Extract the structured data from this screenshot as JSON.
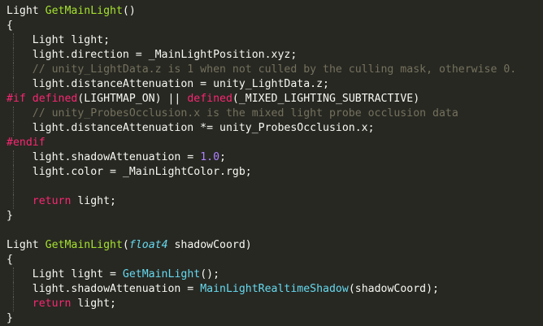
{
  "theme": {
    "background": "#272822",
    "plain": "#f8f8f2",
    "function": "#a6e22e",
    "comment": "#75715e",
    "keyword": "#f92672",
    "number": "#ae81ff",
    "type_italic": "#66d9ef",
    "guide": "#5a5a50"
  },
  "lines": [
    {
      "guide": false,
      "tokens": [
        {
          "text": "Light ",
          "c": "plain"
        },
        {
          "text": "GetMainLight",
          "c": "function"
        },
        {
          "text": "()",
          "c": "plain"
        }
      ]
    },
    {
      "guide": false,
      "tokens": [
        {
          "text": "{",
          "c": "plain"
        }
      ]
    },
    {
      "guide": true,
      "tokens": [
        {
          "text": "    Light light;",
          "c": "plain"
        }
      ]
    },
    {
      "guide": true,
      "tokens": [
        {
          "text": "    light.direction = _MainLightPosition.xyz;",
          "c": "plain"
        }
      ]
    },
    {
      "guide": true,
      "tokens": [
        {
          "text": "    // unity_LightData.z is 1 when not culled by the culling mask, otherwise 0.",
          "c": "comment"
        }
      ]
    },
    {
      "guide": true,
      "tokens": [
        {
          "text": "    light.distanceAttenuation = unity_LightData.z;",
          "c": "plain"
        }
      ]
    },
    {
      "guide": false,
      "tokens": [
        {
          "text": "#if ",
          "c": "keyword"
        },
        {
          "text": "defined",
          "c": "keyword"
        },
        {
          "text": "(LIGHTMAP_ON) || ",
          "c": "plain"
        },
        {
          "text": "defined",
          "c": "keyword"
        },
        {
          "text": "(_MIXED_LIGHTING_SUBTRACTIVE)",
          "c": "plain"
        }
      ]
    },
    {
      "guide": true,
      "tokens": [
        {
          "text": "    // unity_ProbesOcclusion.x is the mixed light probe occlusion data",
          "c": "comment"
        }
      ]
    },
    {
      "guide": true,
      "tokens": [
        {
          "text": "    light.distanceAttenuation *= unity_ProbesOcclusion.x;",
          "c": "plain"
        }
      ]
    },
    {
      "guide": false,
      "tokens": [
        {
          "text": "#endif",
          "c": "keyword"
        }
      ]
    },
    {
      "guide": true,
      "tokens": [
        {
          "text": "    light.shadowAttenuation = ",
          "c": "plain"
        },
        {
          "text": "1.0",
          "c": "number"
        },
        {
          "text": ";",
          "c": "plain"
        }
      ]
    },
    {
      "guide": true,
      "tokens": [
        {
          "text": "    light.color = _MainLightColor.rgb;",
          "c": "plain"
        }
      ]
    },
    {
      "guide": true,
      "tokens": [
        {
          "text": "",
          "c": "plain"
        }
      ]
    },
    {
      "guide": true,
      "tokens": [
        {
          "text": "    ",
          "c": "plain"
        },
        {
          "text": "return",
          "c": "keyword"
        },
        {
          "text": " light;",
          "c": "plain"
        }
      ]
    },
    {
      "guide": false,
      "tokens": [
        {
          "text": "}",
          "c": "plain"
        }
      ]
    },
    {
      "guide": false,
      "tokens": [
        {
          "text": "",
          "c": "plain"
        }
      ]
    },
    {
      "guide": false,
      "tokens": [
        {
          "text": "Light ",
          "c": "plain"
        },
        {
          "text": "GetMainLight",
          "c": "function"
        },
        {
          "text": "(",
          "c": "plain"
        },
        {
          "text": "float4",
          "c": "type_italic",
          "italic": true
        },
        {
          "text": " shadowCoord)",
          "c": "plain"
        }
      ]
    },
    {
      "guide": false,
      "tokens": [
        {
          "text": "{",
          "c": "plain"
        }
      ]
    },
    {
      "guide": true,
      "tokens": [
        {
          "text": "    Light light = ",
          "c": "plain"
        },
        {
          "text": "GetMainLight",
          "c": "type_italic"
        },
        {
          "text": "();",
          "c": "plain"
        }
      ]
    },
    {
      "guide": true,
      "tokens": [
        {
          "text": "    light.shadowAttenuation = ",
          "c": "plain"
        },
        {
          "text": "MainLightRealtimeShadow",
          "c": "type_italic"
        },
        {
          "text": "(shadowCoord);",
          "c": "plain"
        }
      ]
    },
    {
      "guide": true,
      "tokens": [
        {
          "text": "    ",
          "c": "plain"
        },
        {
          "text": "return",
          "c": "keyword"
        },
        {
          "text": " light;",
          "c": "plain"
        }
      ]
    },
    {
      "guide": false,
      "tokens": [
        {
          "text": "}",
          "c": "plain"
        }
      ]
    }
  ]
}
